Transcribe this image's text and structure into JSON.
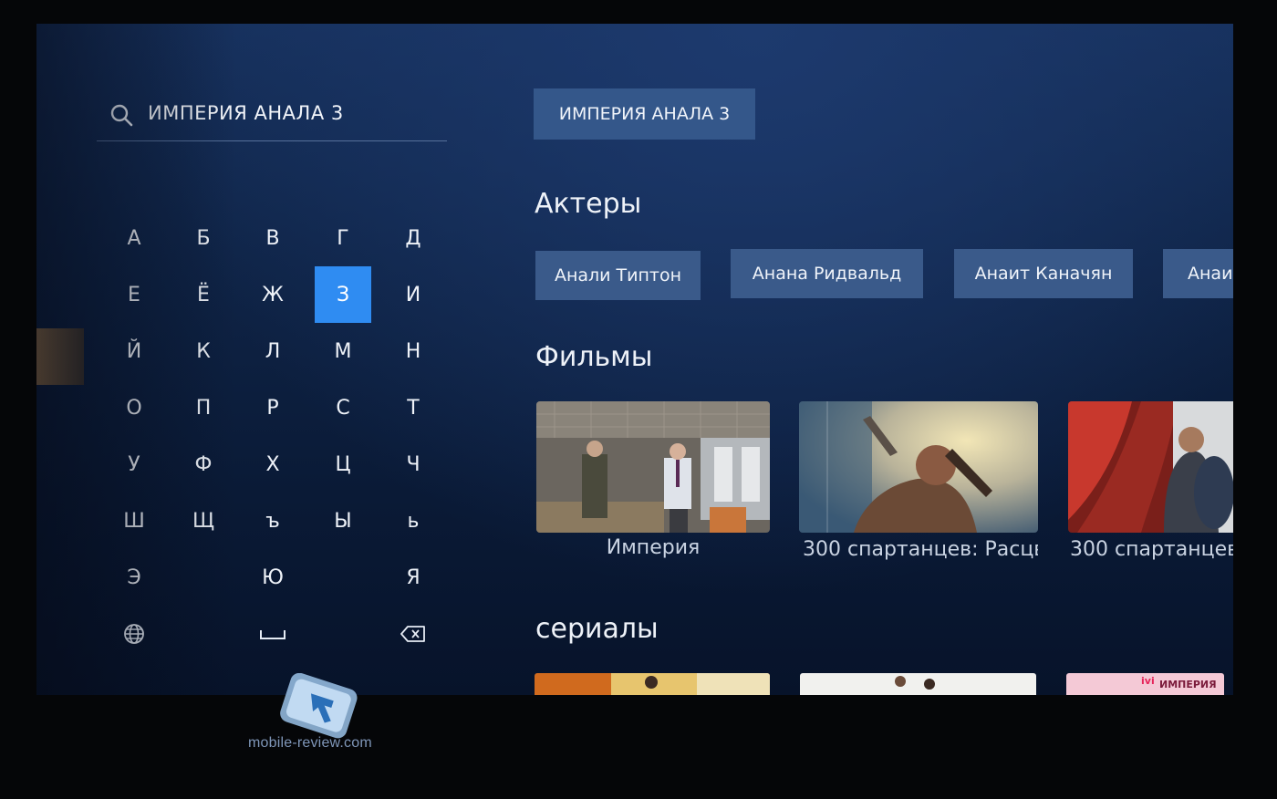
{
  "search": {
    "query": "ИМПЕРИЯ  АНАЛА 3",
    "icon": "search-icon"
  },
  "keyboard": {
    "keys": [
      "А",
      "Б",
      "В",
      "Г",
      "Д",
      "Е",
      "Ё",
      "Ж",
      "З",
      "И",
      "Й",
      "К",
      "Л",
      "М",
      "Н",
      "О",
      "П",
      "Р",
      "С",
      "Т",
      "У",
      "Ф",
      "Х",
      "Ц",
      "Ч",
      "Ш",
      "Щ",
      "ъ",
      "Ы",
      "ь",
      "Э",
      "Ю",
      "Я"
    ],
    "selected": "З",
    "icons": {
      "language": "globe-icon",
      "space": "space-icon",
      "backspace": "backspace-icon"
    },
    "colors": {
      "selected": "#2f8cf2"
    }
  },
  "suggestion": {
    "label": "ИМПЕРИЯ АНАЛА 3"
  },
  "actors": {
    "title": "Актеры",
    "items": [
      "Анали Типтон",
      "Анана Ридвальд",
      "Анаит Каначян",
      "Анаи"
    ]
  },
  "movies": {
    "title": "Фильмы",
    "items": [
      "Империя",
      "300 спартанцев: Расцв",
      "300 спартанцев"
    ]
  },
  "series": {
    "title": "сериалы",
    "badge": "ivi",
    "poster_text": "ИМПЕРИЯ"
  },
  "watermark": {
    "text": "mobile-review.com"
  },
  "colors": {
    "chip": "#3a5a8a",
    "accent": "#2f8cf2"
  }
}
